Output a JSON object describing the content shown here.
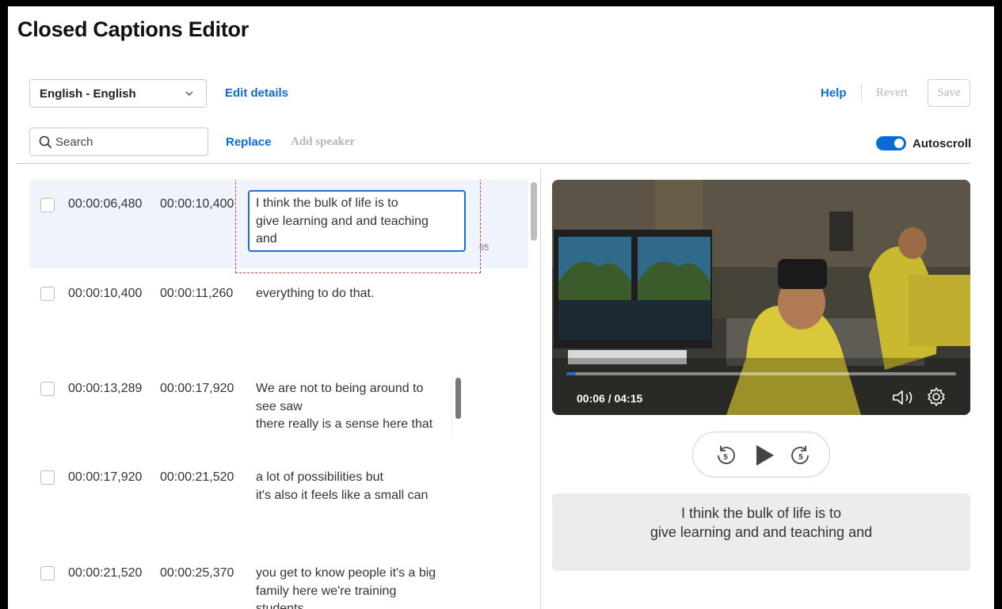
{
  "app": {
    "title": "Closed Captions Editor"
  },
  "toolbar": {
    "language_selected": "English - English",
    "edit_details": "Edit details",
    "help": "Help",
    "revert": "Revert",
    "save": "Save",
    "search_placeholder": "Search",
    "replace": "Replace",
    "add_speaker": "Add speaker",
    "autoscroll_label": "Autoscroll",
    "autoscroll_on": true
  },
  "captions": [
    {
      "start": "00:00:06,480",
      "end": "00:00:10,400",
      "text": "I think the bulk of life is to\ngive learning and and teaching\nand",
      "char_count": "65",
      "selected": true
    },
    {
      "start": "00:00:10,400",
      "end": "00:00:11,260",
      "text": "everything to do that."
    },
    {
      "start": "00:00:13,289",
      "end": "00:00:17,920",
      "text": "We are not to being around to\nsee saw\nthere really is a sense here that"
    },
    {
      "start": "00:00:17,920",
      "end": "00:00:21,520",
      "text": "a lot of possibilities but\nit's also it feels like a small can"
    },
    {
      "start": "00:00:21,520",
      "end": "00:00:25,370",
      "text": "you get to know people it's a big\nfamily here we're training\nstudents"
    }
  ],
  "player": {
    "time": "00:06 / 04:15",
    "progress_fraction": 0.024,
    "accent": "#1f6fd0"
  },
  "preview": {
    "text": "I think the bulk of life is to\ngive learning and and teaching and"
  },
  "colors": {
    "link": "#0b6bd6",
    "disabled": "#b5b5b5",
    "selected_row": "#eef3fc"
  }
}
